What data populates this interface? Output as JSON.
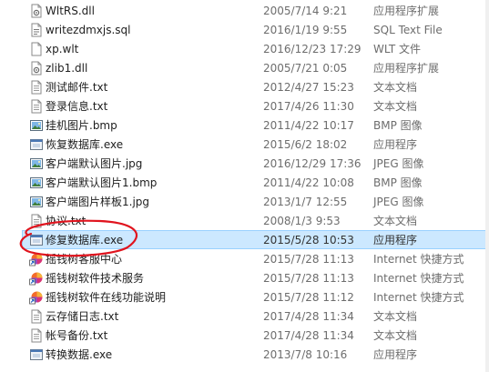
{
  "files": [
    {
      "name": "WltRS.dll",
      "date": "2005/7/14 9:21",
      "type": "应用程序扩展",
      "icon": "dll-icon"
    },
    {
      "name": "writezdmxjs.sql",
      "date": "2016/1/19 9:55",
      "type": "SQL Text File",
      "icon": "sql-file-icon"
    },
    {
      "name": "xp.wlt",
      "date": "2016/12/23 17:29",
      "type": "WLT 文件",
      "icon": "generic-file-icon"
    },
    {
      "name": "zlib1.dll",
      "date": "2005/7/21 0:05",
      "type": "应用程序扩展",
      "icon": "dll-icon"
    },
    {
      "name": "测试邮件.txt",
      "date": "2012/4/27 15:23",
      "type": "文本文档",
      "icon": "text-file-icon"
    },
    {
      "name": "登录信息.txt",
      "date": "2017/4/26 11:30",
      "type": "文本文档",
      "icon": "text-file-icon"
    },
    {
      "name": "挂机图片.bmp",
      "date": "2011/4/22 10:17",
      "type": "BMP 图像",
      "icon": "image-file-icon"
    },
    {
      "name": "恢复数据库.exe",
      "date": "2015/6/2 18:02",
      "type": "应用程序",
      "icon": "exe-icon"
    },
    {
      "name": "客户端默认图片.jpg",
      "date": "2016/12/29 17:36",
      "type": "JPEG 图像",
      "icon": "image-file-icon"
    },
    {
      "name": "客户端默认图片1.bmp",
      "date": "2011/4/22 10:08",
      "type": "BMP 图像",
      "icon": "image-file-icon"
    },
    {
      "name": "客户端图片样板1.jpg",
      "date": "2013/1/7 12:55",
      "type": "JPEG 图像",
      "icon": "image-file-icon"
    },
    {
      "name": "协议.txt",
      "date": "2008/1/3 9:53",
      "type": "文本文档",
      "icon": "text-file-icon"
    },
    {
      "name": "修复数据库.exe",
      "date": "2015/5/28 10:53",
      "type": "应用程序",
      "icon": "exe-icon",
      "selected": true
    },
    {
      "name": "摇钱树客服中心",
      "date": "2015/7/28 11:13",
      "type": "Internet 快捷方式",
      "icon": "internet-shortcut-icon"
    },
    {
      "name": "摇钱树软件技术服务",
      "date": "2015/7/28 11:13",
      "type": "Internet 快捷方式",
      "icon": "internet-shortcut-icon"
    },
    {
      "name": "摇钱树软件在线功能说明",
      "date": "2015/7/28 11:12",
      "type": "Internet 快捷方式",
      "icon": "internet-shortcut-icon"
    },
    {
      "name": "云存储日志.txt",
      "date": "2017/4/28 11:34",
      "type": "文本文档",
      "icon": "text-file-icon"
    },
    {
      "name": "帐号备份.txt",
      "date": "2017/4/28 11:34",
      "type": "文本文档",
      "icon": "text-file-icon"
    },
    {
      "name": "转换数据.exe",
      "date": "2013/7/8 10:16",
      "type": "应用程序",
      "icon": "exe-icon"
    }
  ],
  "colors": {
    "selection_bg": "#cce8ff",
    "selection_border": "#99d1ff",
    "annotation": "#e0141e"
  }
}
